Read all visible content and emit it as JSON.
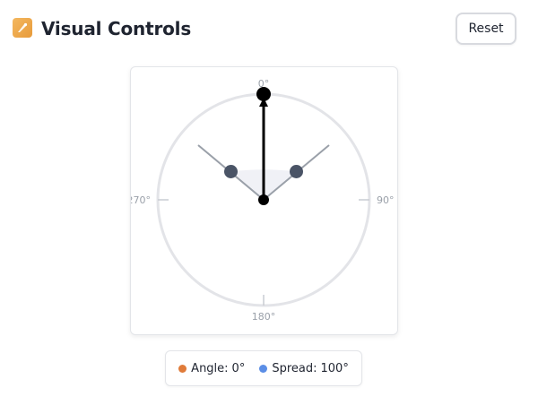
{
  "header": {
    "title": "Visual Controls",
    "icon": "paint-palette-icon",
    "reset_label": "Reset"
  },
  "dial": {
    "labels": {
      "top": "0°",
      "right": "90°",
      "bottom": "180°",
      "left": "270°"
    }
  },
  "legend": {
    "angle_label": "Angle:",
    "angle_value": "0°",
    "spread_label": "Spread:",
    "spread_value": "100°"
  },
  "colors": {
    "angle_dot": "#e07b3a",
    "spread_dot": "#5b8ee6",
    "handle": "#4a5466",
    "needle": "#000000",
    "ring": "#e3e4e8"
  }
}
